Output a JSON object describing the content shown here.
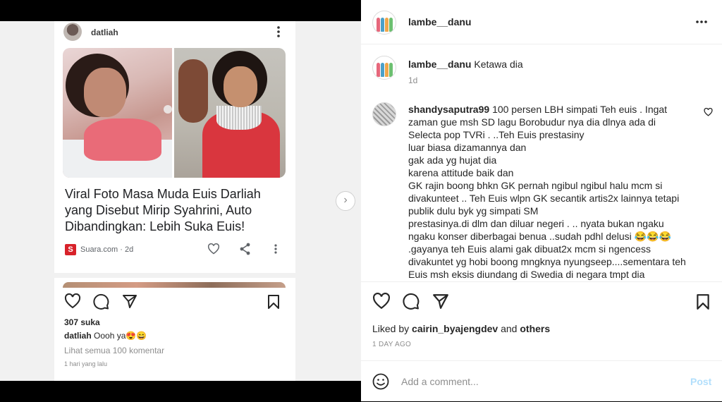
{
  "left": {
    "username": "datliah",
    "headline": "Viral Foto Masa Muda Euis Darliah yang Disebut Mirip Syahrini, Auto Dibandingkan: Lebih Suka Euis!",
    "source_logo": "S",
    "source": "Suara.com · 2d",
    "likes": "307 suka",
    "caption_user": "datliah",
    "caption_text": " Oooh ya😍😄",
    "view_comments": "Lihat semua 100 komentar",
    "time": "1 hari yang lalu",
    "next_icon": "›"
  },
  "right": {
    "username": "lambe__danu",
    "caption_user": "lambe__danu",
    "caption_text": "Ketawa dia",
    "caption_time": "1d",
    "comment_user": "shandysaputra99",
    "comment_text": "100 persen LBH simpati Teh euis . Ingat zaman gue msh SD lagu Borobudur nya dia dlnya ada di Selecta pop TVRi . ..Teh Euis prestasiny\nluar biasa dizamannya dan\ngak ada yg hujat dia\nkarena attitude baik dan\nGK rajin boong bhkn GK pernah ngibul ngibul halu mcm si divakunteet .. Teh Euis wlpn GK secantik artis2x lainnya tetapi publik dulu byk yg simpati SM\nprestasinya.di dlm dan diluar negeri . .. nyata bukan ngaku ngaku konser diberbagai benua ..sudah pdhl delusi 😂😂😂\n.gayanya teh Euis alami gak dibuat2x mcm si ngencess divakuntet yg hobi boong mngknya nyungseep....sementara teh Euis msh eksis diundang di Swedia di negara tmpt dia",
    "liked_by_prefix": "Liked by ",
    "liked_by_user": "cairin_byajengdev",
    "liked_by_and": " and ",
    "liked_by_others": "others",
    "time": "1 DAY AGO",
    "comment_placeholder": "Add a comment...",
    "post_label": "Post"
  },
  "icons": [
    "heart-icon",
    "comment-icon",
    "share-icon",
    "bookmark-icon",
    "more-icon",
    "smile-icon"
  ],
  "colors": {
    "link_blue": "#b2dffc",
    "source_red": "#d8222a",
    "muted": "#8e8e8e"
  }
}
